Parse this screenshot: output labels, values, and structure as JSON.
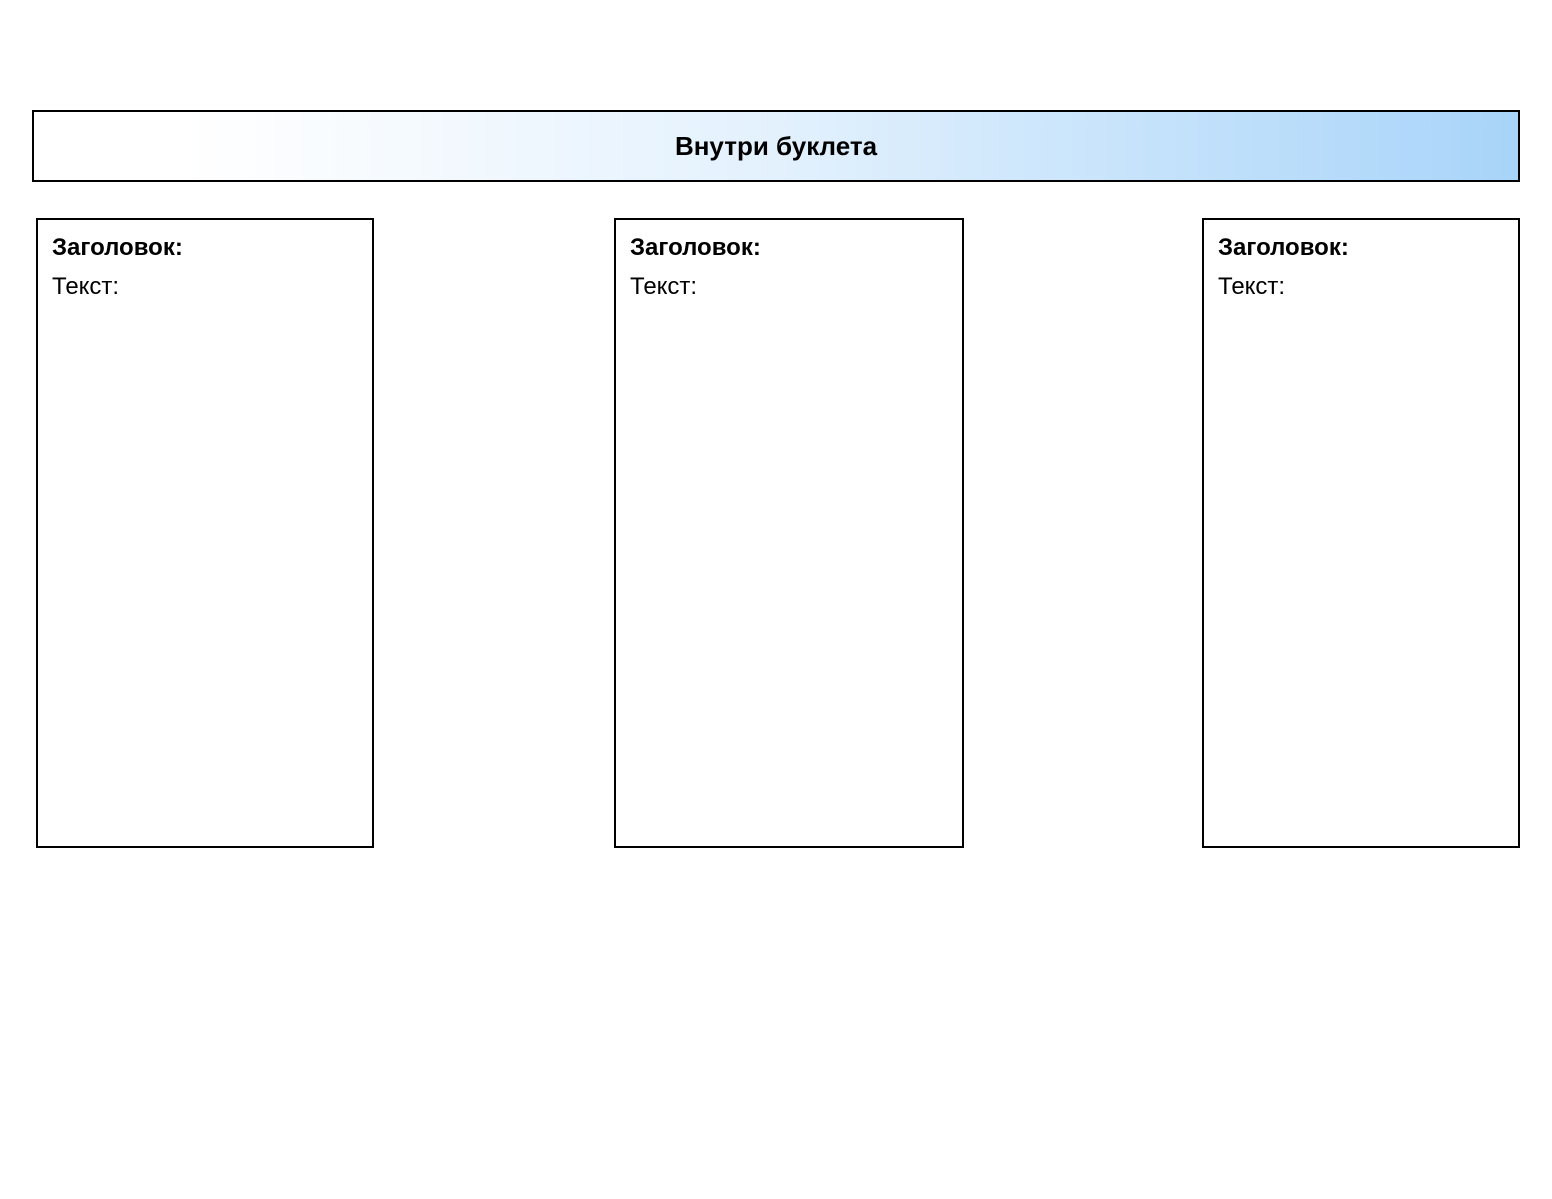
{
  "banner": {
    "title": "Внутри буклета"
  },
  "panels": [
    {
      "heading_label": "Заголовок:",
      "text_label": "Текст:"
    },
    {
      "heading_label": "Заголовок:",
      "text_label": "Текст:"
    },
    {
      "heading_label": "Заголовок:",
      "text_label": "Текст:"
    }
  ]
}
